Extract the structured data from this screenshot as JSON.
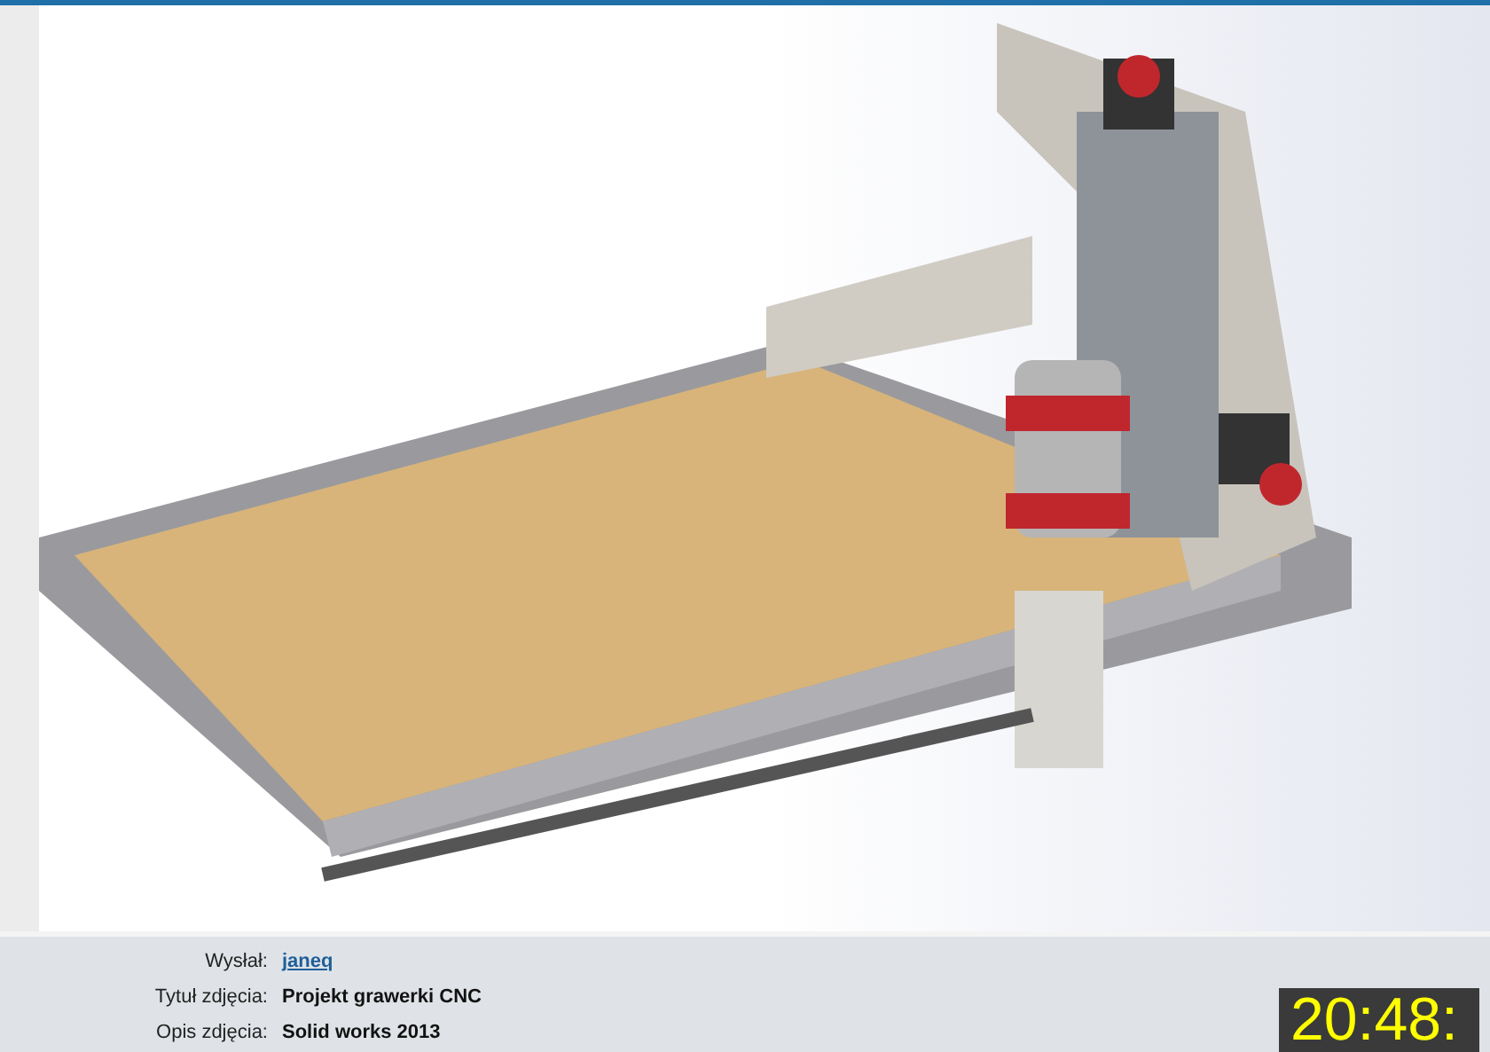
{
  "photo": {
    "kind": "cnc-render"
  },
  "details": [
    {
      "label": "Wysłał:",
      "value": "janeq",
      "kind": "link"
    },
    {
      "label": "Tytuł zdjęcia:",
      "value": "Projekt grawerki CNC",
      "kind": "text"
    },
    {
      "label": "Opis zdjęcia:",
      "value": "Solid works 2013",
      "kind": "text"
    }
  ],
  "clock": "20:48:"
}
